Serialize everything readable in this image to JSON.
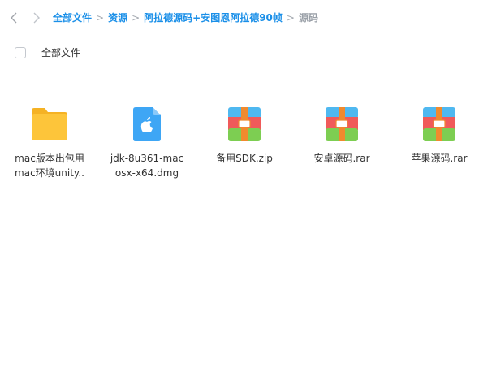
{
  "breadcrumb": {
    "items": [
      "全部文件",
      "资源",
      "阿拉德源码+安图恩阿拉德90帧",
      "源码"
    ],
    "separator": ">"
  },
  "toolbar": {
    "select_all_label": "全部文件"
  },
  "files": [
    {
      "name_line1": "mac版本出包用",
      "name_line2": "mac环境unity..",
      "icon": "folder-icon"
    },
    {
      "name_line1": "jdk-8u361-mac",
      "name_line2": "osx-x64.dmg",
      "icon": "apple-dmg-icon"
    },
    {
      "name_line1": "备用SDK.zip",
      "name_line2": "",
      "icon": "archive-icon"
    },
    {
      "name_line1": "安卓源码.rar",
      "name_line2": "",
      "icon": "archive-icon"
    },
    {
      "name_line1": "苹果源码.rar",
      "name_line2": "",
      "icon": "archive-icon"
    }
  ],
  "colors": {
    "link": "#1a8fe8",
    "current": "#9aa0a8",
    "folder": "#fdc53a",
    "dmg": "#3ea6f5"
  }
}
